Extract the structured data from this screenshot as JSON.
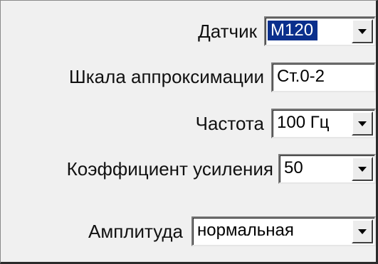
{
  "form": {
    "sensor": {
      "label": "Датчик",
      "value": "M120",
      "icon": "chevron-down-icon"
    },
    "scale": {
      "label": "Шкала аппроксимации",
      "value": "Ст.0-2"
    },
    "frequency": {
      "label": "Частота",
      "value": "100 Гц",
      "icon": "chevron-down-icon"
    },
    "gain": {
      "label": "Коэффициент усиления",
      "value": "50",
      "icon": "chevron-down-icon"
    },
    "amplitude": {
      "label": "Амплитуда",
      "value": "нормальная",
      "icon": "chevron-down-icon"
    }
  },
  "colors": {
    "selection": "#0a2f8c",
    "panel": "#f0f0f0",
    "field": "#ffffff"
  }
}
